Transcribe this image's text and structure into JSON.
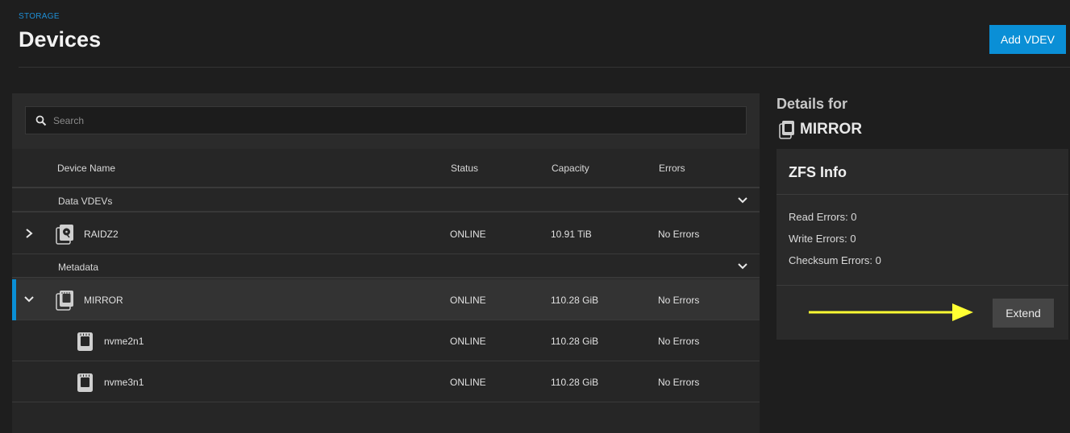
{
  "header": {
    "breadcrumb": "STORAGE",
    "title": "Devices",
    "add_vdev_label": "Add VDEV"
  },
  "search": {
    "placeholder": "Search"
  },
  "table": {
    "columns": [
      "Device Name",
      "Status",
      "Capacity",
      "Errors"
    ],
    "groups": [
      {
        "label": "Data VDEVs",
        "rows": [
          {
            "name": "RAIDZ2",
            "status": "ONLINE",
            "capacity": "10.91 TiB",
            "errors": "No Errors",
            "icon": "hdd-vdev-icon",
            "expanded": false
          }
        ]
      },
      {
        "label": "Metadata",
        "rows": [
          {
            "name": "MIRROR",
            "status": "ONLINE",
            "capacity": "110.28 GiB",
            "errors": "No Errors",
            "icon": "ssd-vdev-icon",
            "expanded": true,
            "selected": true
          },
          {
            "name": "nvme2n1",
            "status": "ONLINE",
            "capacity": "110.28 GiB",
            "errors": "No Errors",
            "icon": "ssd-disk-icon"
          },
          {
            "name": "nvme3n1",
            "status": "ONLINE",
            "capacity": "110.28 GiB",
            "errors": "No Errors",
            "icon": "ssd-disk-icon"
          }
        ]
      }
    ]
  },
  "details": {
    "heading": "Details for",
    "device_name": "MIRROR",
    "zfs_info": {
      "title": "ZFS Info",
      "read_errors": "Read Errors:  0",
      "write_errors": "Write Errors:  0",
      "checksum_errors": "Checksum Errors:  0"
    },
    "extend_label": "Extend"
  },
  "colors": {
    "accent": "#0a8fd6",
    "annotation_arrow": "#ffff33"
  }
}
